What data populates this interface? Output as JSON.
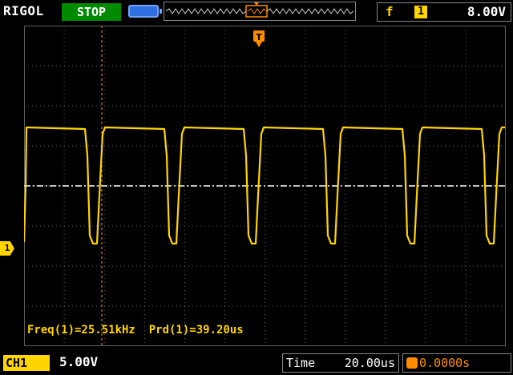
{
  "header": {
    "brand": "RIGOL",
    "run_status": "STOP",
    "trigger": {
      "edge_glyph": "f",
      "source": "1",
      "level": "8.00V"
    }
  },
  "channel": {
    "marker": "1",
    "label": "CH1",
    "scale": "5.00V"
  },
  "measurements": {
    "text": "Freq(1)=25.51kHz  Prd(1)=39.20us"
  },
  "timebase": {
    "label": "Time",
    "scale": "20.00us",
    "offset": "0.0000s"
  },
  "trigger_marker": "T",
  "icons": [
    "battery-icon",
    "memory-depth-bar",
    "rising-edge-icon",
    "trigger-position-icon"
  ],
  "colors": {
    "trace": "#ffd500",
    "stop_bg": "#008a00",
    "trigger": "#ff8c00",
    "grid": "#606060"
  }
}
